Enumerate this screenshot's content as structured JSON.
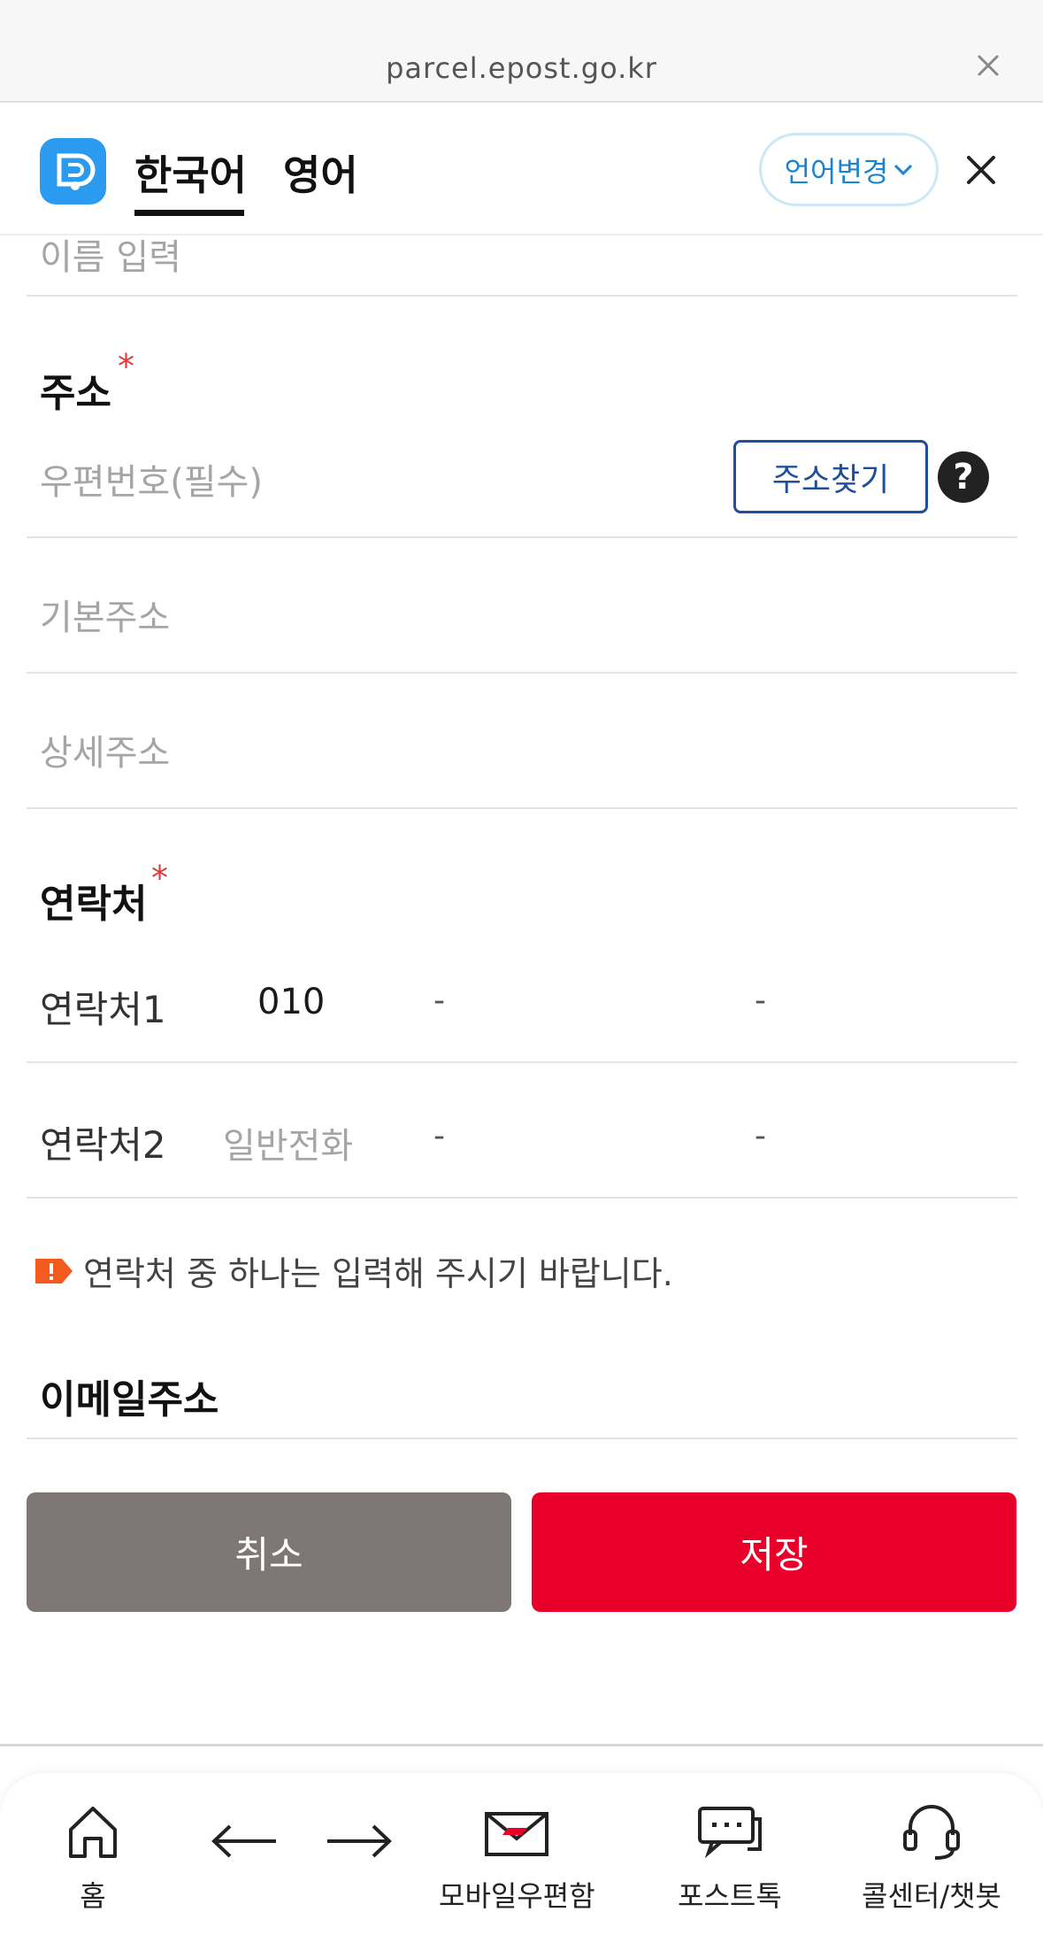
{
  "browser": {
    "url": "parcel.epost.go.kr"
  },
  "header": {
    "tabs": [
      {
        "label": "한국어"
      },
      {
        "label": "영어"
      }
    ],
    "lang_change_label": "언어변경"
  },
  "form": {
    "name_placeholder": "이름 입력",
    "address": {
      "label": "주소",
      "required_mark": "*",
      "postal_placeholder": "우편번호(필수)",
      "search_button": "주소찾기",
      "help_glyph": "?",
      "basic_placeholder": "기본주소",
      "detail_placeholder": "상세주소"
    },
    "contact": {
      "label": "연락처",
      "required_mark": "*",
      "contact1": {
        "label": "연락처1",
        "prefix": "010",
        "sep1": "-",
        "sep2": "-"
      },
      "contact2": {
        "label": "연락처2",
        "prefix_placeholder": "일반전화",
        "sep1": "-",
        "sep2": "-"
      },
      "notice": "연락처 중 하나는 입력해 주시기 바랍니다."
    },
    "email": {
      "label": "이메일주소"
    }
  },
  "actions": {
    "cancel": "취소",
    "save": "저장"
  },
  "bottom_nav": {
    "items": [
      {
        "label": "홈",
        "icon": "home-icon"
      },
      {
        "label": "",
        "icon": "back-arrow-icon"
      },
      {
        "label": "",
        "icon": "forward-arrow-icon"
      },
      {
        "label": "모바일우편함",
        "icon": "mail-icon"
      },
      {
        "label": "포스트톡",
        "icon": "chat-icon"
      },
      {
        "label": "콜센터/챗봇",
        "icon": "headset-icon"
      }
    ]
  },
  "colors": {
    "brand_red": "#e8002a",
    "cancel_gray": "#7f7776",
    "link_blue": "#1d4f9c",
    "logo_blue": "#2a9bef"
  }
}
